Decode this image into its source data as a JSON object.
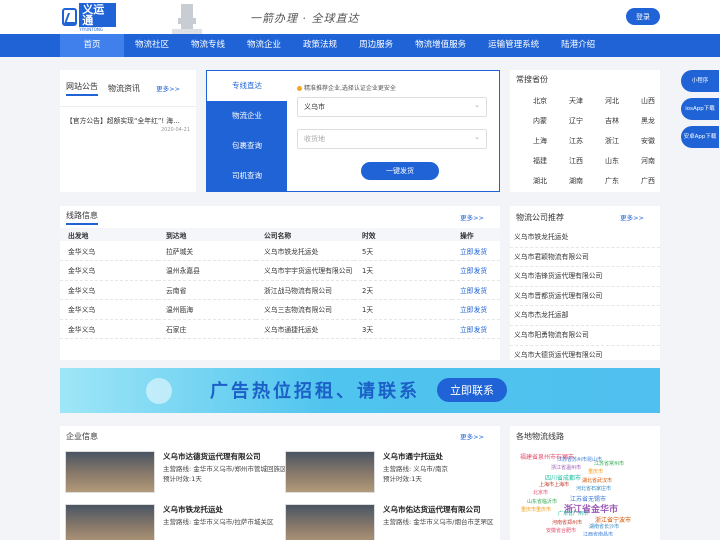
{
  "header": {
    "logo_text": "义运通",
    "logo_sub": "YIYUNTONG",
    "slogan": "一箭办理 · 全球直达",
    "login_label": "登录"
  },
  "nav": [
    "首页",
    "物流社区",
    "物流专线",
    "物流企业",
    "政策法规",
    "周边服务",
    "物流增值服务",
    "运输管理系统",
    "陆港介绍"
  ],
  "news": {
    "tabs": [
      "网站公告",
      "物流资讯"
    ],
    "more": "更多>>",
    "items": [
      {
        "text": "【官方公告】超额实现“全年红”! 海…",
        "date": "2020-04-21"
      }
    ]
  },
  "quick": {
    "tabs": [
      "专线直达",
      "物流企业",
      "包裹查询",
      "司机查询"
    ],
    "tip": "精准推荐企业,选择认证企业更安全",
    "from": "义乌市",
    "to_placeholder": "收货地",
    "submit": "一键发货"
  },
  "provinces": {
    "title": "常搜省份",
    "items": [
      "北京",
      "天津",
      "河北",
      "山西",
      "内蒙",
      "辽宁",
      "吉林",
      "黑龙",
      "上海",
      "江苏",
      "浙江",
      "安徽",
      "福建",
      "江西",
      "山东",
      "河南",
      "湖北",
      "湖南",
      "广东",
      "广西"
    ]
  },
  "lines": {
    "title": "线路信息",
    "more": "更多>>",
    "headers": [
      "出发地",
      "到达地",
      "公司名称",
      "时效",
      "操作"
    ],
    "rows": [
      [
        "金华义乌",
        "拉萨城关",
        "义乌市铁龙托运处",
        "5天",
        "立即发货"
      ],
      [
        "金华义乌",
        "温州永嘉县",
        "义乌市宇宇货运代理有限公司",
        "1天",
        "立即发货"
      ],
      [
        "金华义乌",
        "云南省",
        "浙江战马物流有限公司",
        "2天",
        "立即发货"
      ],
      [
        "金华义乌",
        "温州瓯海",
        "义乌三志物流有限公司",
        "1天",
        "立即发货"
      ],
      [
        "金华义乌",
        "石家庄",
        "义乌市通捷托运处",
        "3天",
        "立即发货"
      ]
    ]
  },
  "companies": {
    "title": "物流公司推荐",
    "more": "更多>>",
    "items": [
      "义乌市铁龙托运处",
      "义乌市君颖物流有限公司",
      "义乌市浩锋货运代理有限公司",
      "义乌市晋都货运代理有限公司",
      "义乌市杰龙托运部",
      "义乌市阳勇物流有限公司",
      "义乌市大德货运代理有限公司"
    ]
  },
  "banner": {
    "text": "广告热位招租、请联系",
    "button": "立即联系"
  },
  "enterprises": {
    "title": "企业信息",
    "more": "更多>>",
    "route_label": "主营路线:",
    "time_label": "预计时效:",
    "items": [
      {
        "name": "义乌市达德货运代理有限公司",
        "route": "金华市义乌市/郑州市管城回族区",
        "time": "1天"
      },
      {
        "name": "义乌市通宁托运处",
        "route": "义乌市/南京",
        "time": "1天"
      },
      {
        "name": "义乌市铁龙托运处",
        "route": "金华市义乌市/拉萨市城关区",
        "time": ""
      },
      {
        "name": "义乌市佑达货运代理有限公司",
        "route": "金华市义乌市/烟台市芝罘区",
        "time": ""
      }
    ]
  },
  "cloud": {
    "title": "各地物流线路",
    "items": [
      "福建省泉州市石狮市",
      "江苏省苏州市昆山市",
      "江苏省常州市",
      "浙江省温州市",
      "重庆市",
      "四川省成都市",
      "湖北省武汉市",
      "上海市上海市",
      "河北省石家庄市",
      "北京市",
      "江苏省无锡市",
      "山东省临沂市",
      "浙江省金华市",
      "重庆市重庆市",
      "广东省广州市",
      "浙江省宁波市",
      "河南省郑州市",
      "湖南省长沙市",
      "安徽省合肥市",
      "江西省南昌市"
    ]
  },
  "float": [
    "小程序",
    "iosApp下载",
    "安卓App下载"
  ],
  "colors": {
    "primary": "#1f63d6",
    "banner": "#4fc4ee"
  }
}
